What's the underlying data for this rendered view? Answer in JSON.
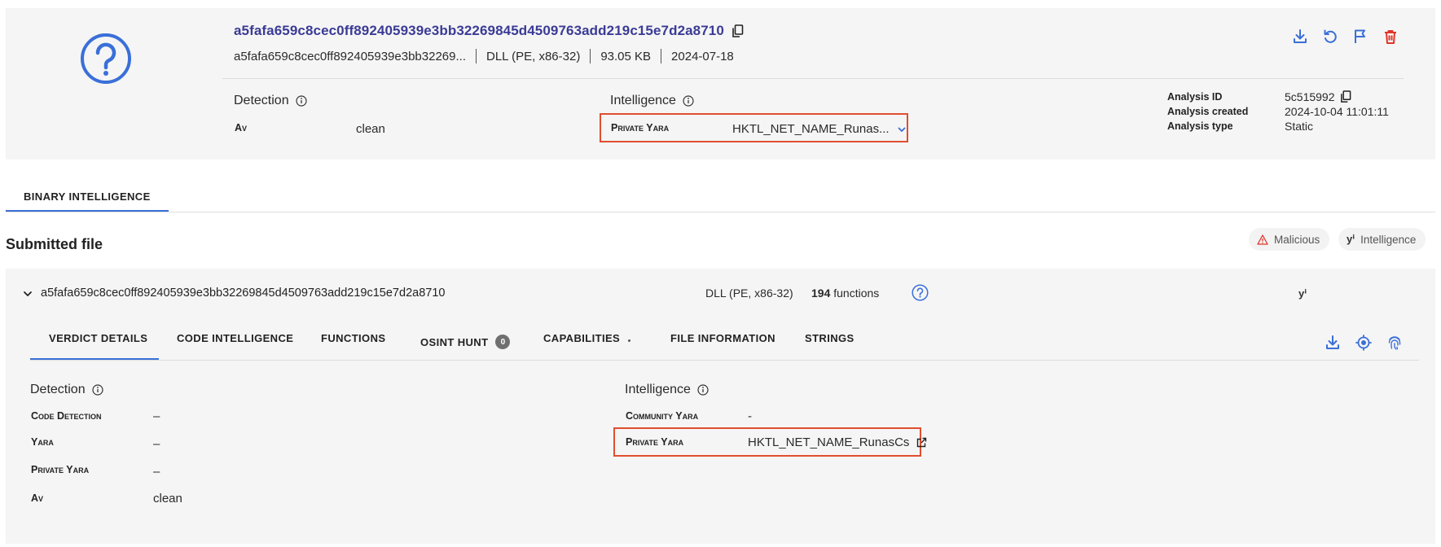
{
  "header": {
    "hash": "a5fafa659c8cec0ff892405939e3bb32269845d4509763add219c15e7d2a8710",
    "hash_short": "a5fafa659c8cec0ff892405939e3bb32269...",
    "file_type": "DLL (PE, x86-32)",
    "size": "93.05 KB",
    "date": "2024-07-18",
    "actions": [
      "download-icon",
      "refresh-icon",
      "flag-icon",
      "trash-icon"
    ]
  },
  "summary": {
    "detection_title": "Detection",
    "av_label": "Av",
    "av_value": "clean",
    "intelligence_title": "Intelligence",
    "private_yara_label": "Private Yara",
    "private_yara_value": "HKTL_NET_NAME_Runas..."
  },
  "analysis": {
    "id_label": "Analysis ID",
    "id_value": "5c515992",
    "created_label": "Analysis created",
    "created_value": "2024-10-04 11:01:11",
    "type_label": "Analysis type",
    "type_value": "Static"
  },
  "main_tabs": [
    {
      "label": "BINARY INTELLIGENCE",
      "active": true
    }
  ],
  "submitted": {
    "title": "Submitted file",
    "chip_malicious": "Malicious",
    "chip_intelligence": "Intelligence",
    "yi_glyph": "yⁱ"
  },
  "file": {
    "hash": "a5fafa659c8cec0ff892405939e3bb32269845d4509763add219c15e7d2a8710",
    "type": "DLL (PE, x86-32)",
    "function_count": "194",
    "functions_word": "functions",
    "yi_glyph": "yⁱ"
  },
  "sub_tabs": {
    "verdict": "VERDICT DETAILS",
    "code_intel": "CODE INTELLIGENCE",
    "functions": "FUNCTIONS",
    "osint": "OSINT HUNT",
    "osint_count": "0",
    "capabilities": "CAPABILITIES",
    "file_info": "FILE INFORMATION",
    "strings": "STRINGS"
  },
  "verdict": {
    "detection_title": "Detection",
    "code_detection_label": "Code Detection",
    "code_detection_value": "–",
    "yara_label": "Yara",
    "yara_value": "–",
    "private_yara_label": "Private Yara",
    "private_yara_value": "–",
    "av_label": "Av",
    "av_value": "clean",
    "intelligence_title": "Intelligence",
    "community_yara_label": "Community Yara",
    "community_yara_value": "-",
    "private_yara2_label": "Private Yara",
    "private_yara2_value": "HKTL_NET_NAME_RunasCs"
  },
  "colors": {
    "accent": "#3a6fd8",
    "hash_title": "#3b3b96",
    "delete": "#e0352b",
    "highlight_box": "#e04e2f",
    "panel_bg": "#f5f5f5"
  }
}
